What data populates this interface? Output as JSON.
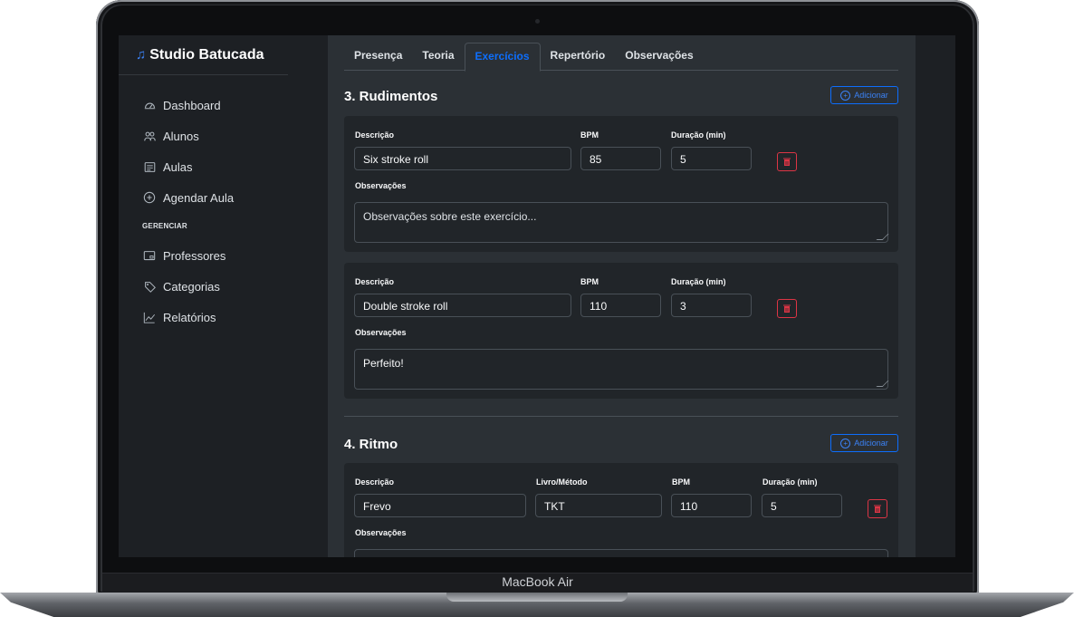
{
  "device_label": "MacBook Air",
  "sidebar": {
    "brand": "Studio Batucada",
    "items": [
      {
        "label": "Dashboard",
        "icon": "gauge-icon"
      },
      {
        "label": "Alunos",
        "icon": "people-icon"
      },
      {
        "label": "Aulas",
        "icon": "calendar-list-icon"
      },
      {
        "label": "Agendar Aula",
        "icon": "plus-circle-icon"
      }
    ],
    "section": "GERENCIAR",
    "manage_items": [
      {
        "label": "Professores",
        "icon": "person-board-icon"
      },
      {
        "label": "Categorias",
        "icon": "tag-icon"
      },
      {
        "label": "Relatórios",
        "icon": "chart-line-icon"
      }
    ]
  },
  "tabs": [
    "Presença",
    "Teoria",
    "Exercícios",
    "Repertório",
    "Observações"
  ],
  "active_tab": "Exercícios",
  "sections": [
    {
      "title": "3. Rudimentos",
      "add_label": "Adicionar",
      "exercises": [
        {
          "desc_label": "Descrição",
          "bpm_label": "BPM",
          "dur_label": "Duração (min)",
          "desc": "Six stroke roll",
          "bpm": "85",
          "dur": "5",
          "obs_label": "Observações",
          "obs": "",
          "obs_placeholder": "Observações sobre este exercício..."
        },
        {
          "desc_label": "Descrição",
          "bpm_label": "BPM",
          "dur_label": "Duração (min)",
          "desc": "Double stroke roll",
          "bpm": "110",
          "dur": "3",
          "obs_label": "Observações",
          "obs": "Perfeito!",
          "obs_placeholder": ""
        }
      ]
    },
    {
      "title": "4. Ritmo",
      "add_label": "Adicionar",
      "exercises": [
        {
          "desc_label": "Descrição",
          "book_label": "Livro/Método",
          "bpm_label": "BPM",
          "dur_label": "Duração (min)",
          "desc": "Frevo",
          "book": "TKT",
          "bpm": "110",
          "dur": "5",
          "obs_label": "Observações"
        }
      ]
    }
  ],
  "colors": {
    "accent": "#0d6efd",
    "danger": "#dc3545",
    "bg": "#212529"
  }
}
